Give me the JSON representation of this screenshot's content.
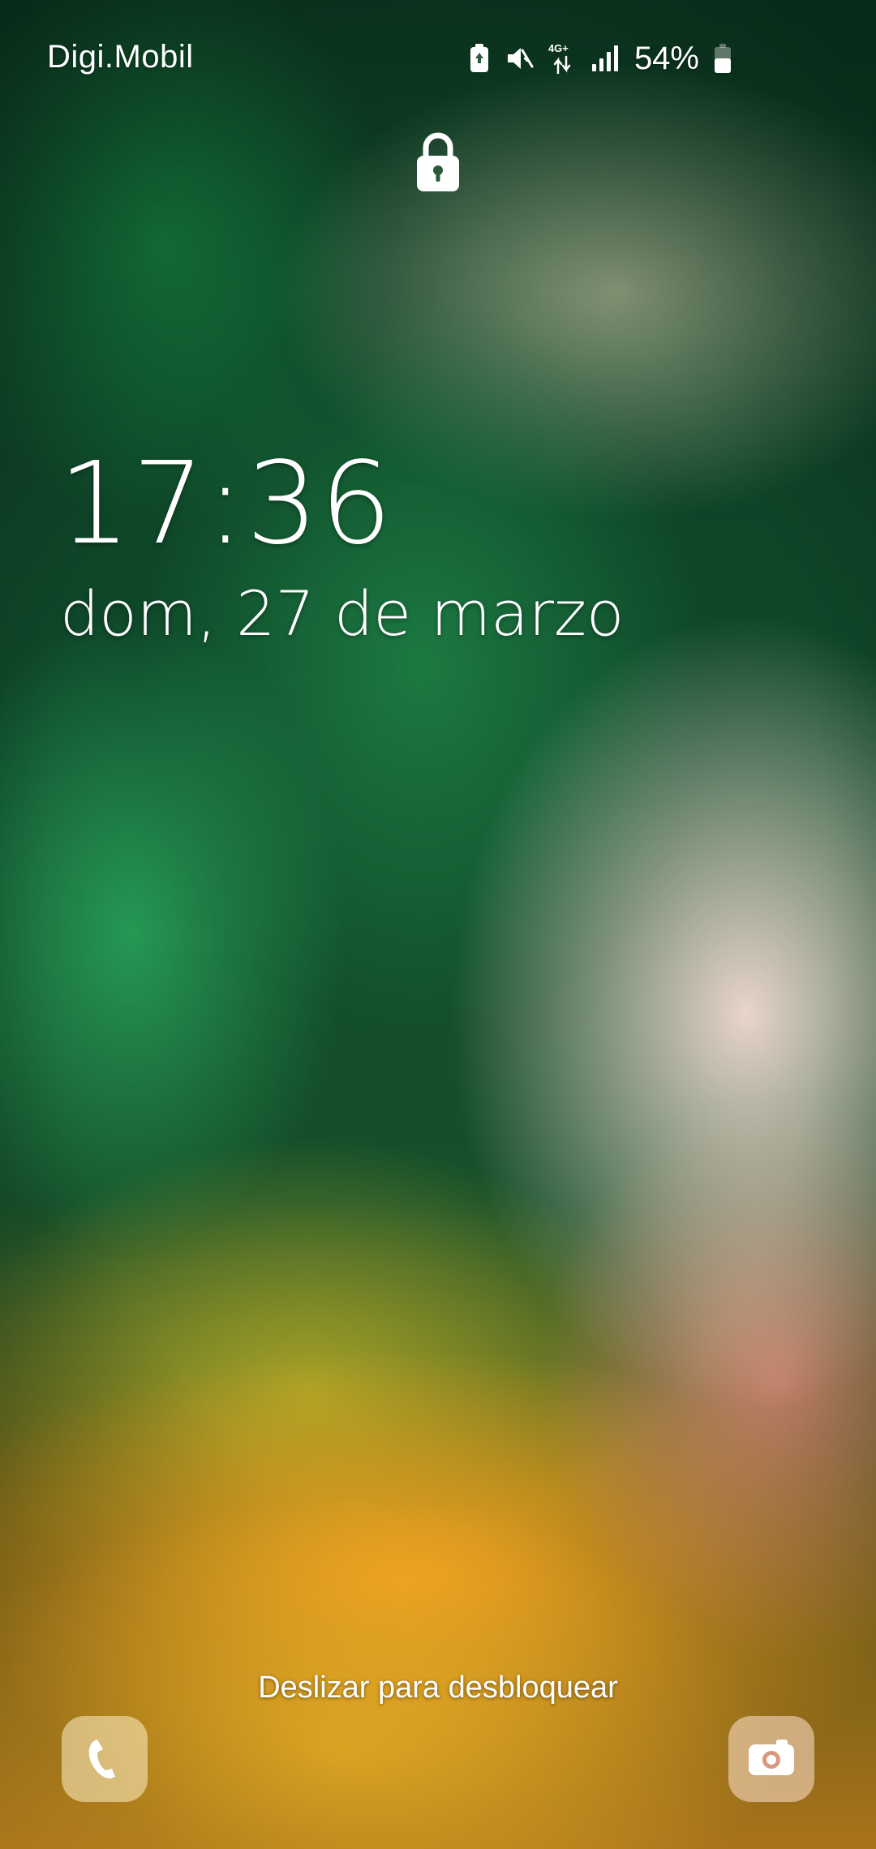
{
  "status_bar": {
    "carrier": "Digi.Mobil",
    "network_type": "4G+",
    "battery_percent": "54%",
    "icons": [
      "battery-saver-icon",
      "mute-icon",
      "network-4g-icon",
      "signal-icon",
      "battery-icon"
    ]
  },
  "lockscreen": {
    "time": "17:36",
    "date": "dom, 27 de marzo",
    "unlock_hint": "Deslizar para desbloquear",
    "shortcuts": {
      "left": "phone-icon",
      "right": "camera-icon"
    }
  },
  "colors": {
    "text": "#ffffff"
  }
}
